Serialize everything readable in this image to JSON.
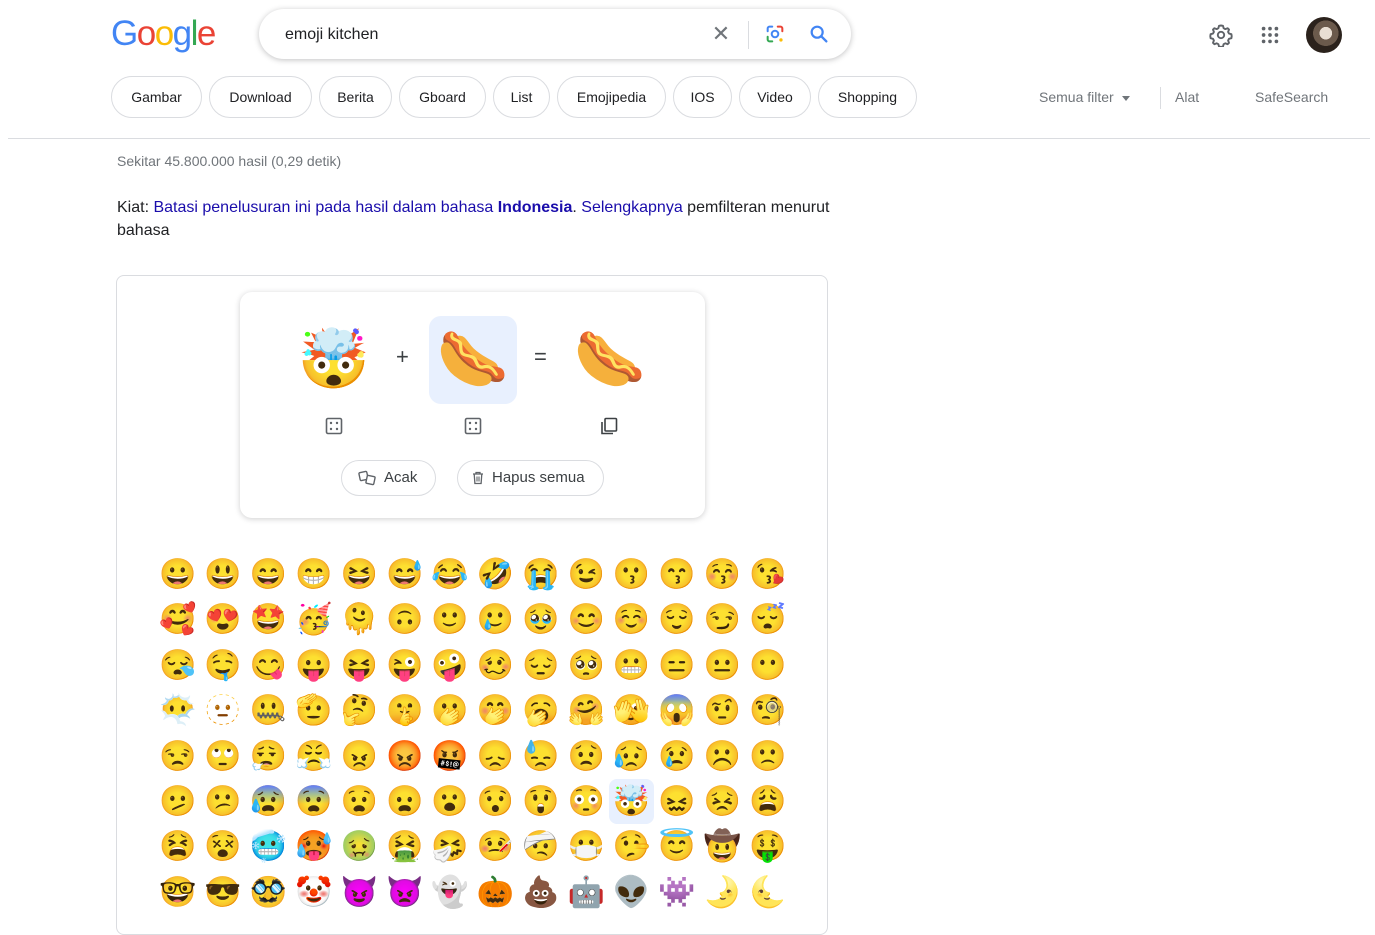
{
  "logo": {
    "letters": [
      "G",
      "o",
      "o",
      "g",
      "l",
      "e"
    ]
  },
  "search": {
    "value": "emoji kitchen",
    "clear_icon": "close-icon",
    "lens_icon": "google-lens-icon",
    "search_icon": "search-icon"
  },
  "header_icons": {
    "settings": "gear-icon",
    "apps": "apps-grid-icon",
    "avatar": "user-avatar"
  },
  "chips": [
    "Gambar",
    "Download",
    "Berita",
    "Gboard",
    "List",
    "Emojipedia",
    "IOS",
    "Video",
    "Shopping"
  ],
  "tools": {
    "all_filters": "Semua filter",
    "tools": "Alat",
    "safesearch": "SafeSearch"
  },
  "result_stats": "Sekitar 45.800.000 hasil (0,29 detik)",
  "tip": {
    "prefix": "Kiat:",
    "link1": "Batasi penelusuran ini pada hasil dalam bahasa",
    "lang": "Indonesia",
    "link2": "Selengkapnya",
    "suffix": "pemfilteran menurut bahasa"
  },
  "kitchen": {
    "left_emoji": "🤯",
    "plus": "+",
    "right_emoji": "🌭",
    "equals": "=",
    "result_emoji": "🌭",
    "left_action_icon": "dice-icon",
    "right_action_icon": "dice-icon",
    "result_action_icon": "copy-icon",
    "random_label": "Acak",
    "clear_label": "Hapus semua"
  },
  "emoji_grid": [
    "😀",
    "😃",
    "😄",
    "😁",
    "😆",
    "😅",
    "😂",
    "🤣",
    "😭",
    "😉",
    "😗",
    "😙",
    "😚",
    "😘",
    "🥰",
    "😍",
    "🤩",
    "🥳",
    "🫠",
    "🙃",
    "🙂",
    "🥲",
    "🥹",
    "😊",
    "☺️",
    "😌",
    "😏",
    "😴",
    "😪",
    "🤤",
    "😋",
    "😛",
    "😝",
    "😜",
    "🤪",
    "🥴",
    "😔",
    "🥺",
    "😬",
    "😑",
    "😐",
    "😶",
    "😶‍🌫️",
    "🫥",
    "🤐",
    "🫡",
    "🤔",
    "🤫",
    "🫢",
    "🤭",
    "🥱",
    "🤗",
    "🫣",
    "😱",
    "🤨",
    "🧐",
    "😒",
    "🙄",
    "😮‍💨",
    "😤",
    "😠",
    "😡",
    "🤬",
    "😞",
    "😓",
    "😟",
    "😥",
    "😢",
    "☹️",
    "🙁",
    "🫤",
    "😕",
    "😰",
    "😨",
    "😧",
    "😦",
    "😮",
    "😯",
    "😲",
    "😳",
    "🤯",
    "😖",
    "😣",
    "😩",
    "😫",
    "😵",
    "🥶",
    "🥵",
    "🤢",
    "🤮",
    "🤧",
    "🤒",
    "🤕",
    "😷",
    "🤥",
    "😇",
    "🤠",
    "🤑",
    "🤓",
    "😎",
    "🥸",
    "🤡",
    "😈",
    "👿",
    "👻",
    "🎃",
    "💩",
    "🤖",
    "👽",
    "👾",
    "🌛",
    "🌜"
  ],
  "selected_grid_index": 80
}
